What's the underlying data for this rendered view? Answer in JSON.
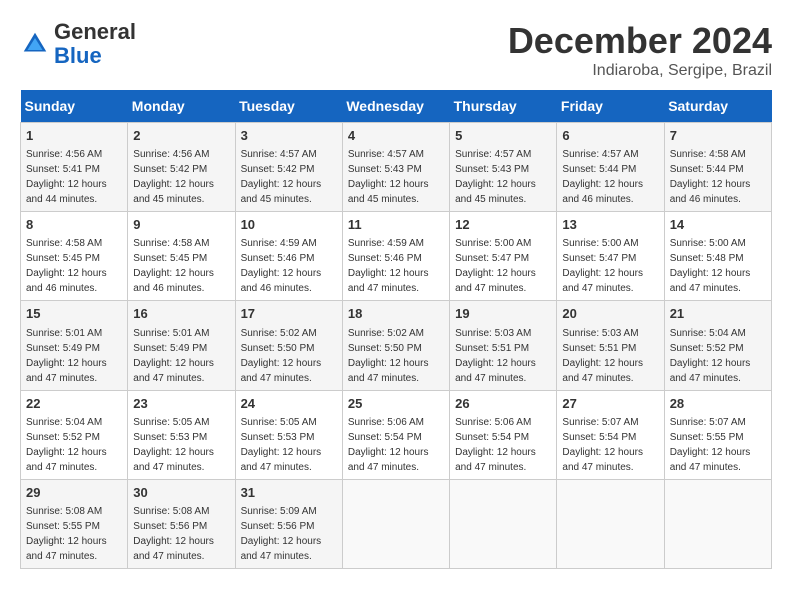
{
  "header": {
    "logo_general": "General",
    "logo_blue": "Blue",
    "month": "December 2024",
    "location": "Indiaroba, Sergipe, Brazil"
  },
  "calendar": {
    "days_of_week": [
      "Sunday",
      "Monday",
      "Tuesday",
      "Wednesday",
      "Thursday",
      "Friday",
      "Saturday"
    ],
    "weeks": [
      [
        {
          "day": "",
          "info": ""
        },
        {
          "day": "2",
          "info": "Sunrise: 4:56 AM\nSunset: 5:42 PM\nDaylight: 12 hours\nand 45 minutes."
        },
        {
          "day": "3",
          "info": "Sunrise: 4:57 AM\nSunset: 5:42 PM\nDaylight: 12 hours\nand 45 minutes."
        },
        {
          "day": "4",
          "info": "Sunrise: 4:57 AM\nSunset: 5:43 PM\nDaylight: 12 hours\nand 45 minutes."
        },
        {
          "day": "5",
          "info": "Sunrise: 4:57 AM\nSunset: 5:43 PM\nDaylight: 12 hours\nand 45 minutes."
        },
        {
          "day": "6",
          "info": "Sunrise: 4:57 AM\nSunset: 5:44 PM\nDaylight: 12 hours\nand 46 minutes."
        },
        {
          "day": "7",
          "info": "Sunrise: 4:58 AM\nSunset: 5:44 PM\nDaylight: 12 hours\nand 46 minutes."
        }
      ],
      [
        {
          "day": "1",
          "info": "Sunrise: 4:56 AM\nSunset: 5:41 PM\nDaylight: 12 hours\nand 44 minutes."
        },
        {
          "day": "",
          "info": ""
        },
        {
          "day": "",
          "info": ""
        },
        {
          "day": "",
          "info": ""
        },
        {
          "day": "",
          "info": ""
        },
        {
          "day": "",
          "info": ""
        },
        {
          "day": "",
          "info": ""
        }
      ],
      [
        {
          "day": "8",
          "info": "Sunrise: 4:58 AM\nSunset: 5:45 PM\nDaylight: 12 hours\nand 46 minutes."
        },
        {
          "day": "9",
          "info": "Sunrise: 4:58 AM\nSunset: 5:45 PM\nDaylight: 12 hours\nand 46 minutes."
        },
        {
          "day": "10",
          "info": "Sunrise: 4:59 AM\nSunset: 5:46 PM\nDaylight: 12 hours\nand 46 minutes."
        },
        {
          "day": "11",
          "info": "Sunrise: 4:59 AM\nSunset: 5:46 PM\nDaylight: 12 hours\nand 47 minutes."
        },
        {
          "day": "12",
          "info": "Sunrise: 5:00 AM\nSunset: 5:47 PM\nDaylight: 12 hours\nand 47 minutes."
        },
        {
          "day": "13",
          "info": "Sunrise: 5:00 AM\nSunset: 5:47 PM\nDaylight: 12 hours\nand 47 minutes."
        },
        {
          "day": "14",
          "info": "Sunrise: 5:00 AM\nSunset: 5:48 PM\nDaylight: 12 hours\nand 47 minutes."
        }
      ],
      [
        {
          "day": "15",
          "info": "Sunrise: 5:01 AM\nSunset: 5:49 PM\nDaylight: 12 hours\nand 47 minutes."
        },
        {
          "day": "16",
          "info": "Sunrise: 5:01 AM\nSunset: 5:49 PM\nDaylight: 12 hours\nand 47 minutes."
        },
        {
          "day": "17",
          "info": "Sunrise: 5:02 AM\nSunset: 5:50 PM\nDaylight: 12 hours\nand 47 minutes."
        },
        {
          "day": "18",
          "info": "Sunrise: 5:02 AM\nSunset: 5:50 PM\nDaylight: 12 hours\nand 47 minutes."
        },
        {
          "day": "19",
          "info": "Sunrise: 5:03 AM\nSunset: 5:51 PM\nDaylight: 12 hours\nand 47 minutes."
        },
        {
          "day": "20",
          "info": "Sunrise: 5:03 AM\nSunset: 5:51 PM\nDaylight: 12 hours\nand 47 minutes."
        },
        {
          "day": "21",
          "info": "Sunrise: 5:04 AM\nSunset: 5:52 PM\nDaylight: 12 hours\nand 47 minutes."
        }
      ],
      [
        {
          "day": "22",
          "info": "Sunrise: 5:04 AM\nSunset: 5:52 PM\nDaylight: 12 hours\nand 47 minutes."
        },
        {
          "day": "23",
          "info": "Sunrise: 5:05 AM\nSunset: 5:53 PM\nDaylight: 12 hours\nand 47 minutes."
        },
        {
          "day": "24",
          "info": "Sunrise: 5:05 AM\nSunset: 5:53 PM\nDaylight: 12 hours\nand 47 minutes."
        },
        {
          "day": "25",
          "info": "Sunrise: 5:06 AM\nSunset: 5:54 PM\nDaylight: 12 hours\nand 47 minutes."
        },
        {
          "day": "26",
          "info": "Sunrise: 5:06 AM\nSunset: 5:54 PM\nDaylight: 12 hours\nand 47 minutes."
        },
        {
          "day": "27",
          "info": "Sunrise: 5:07 AM\nSunset: 5:54 PM\nDaylight: 12 hours\nand 47 minutes."
        },
        {
          "day": "28",
          "info": "Sunrise: 5:07 AM\nSunset: 5:55 PM\nDaylight: 12 hours\nand 47 minutes."
        }
      ],
      [
        {
          "day": "29",
          "info": "Sunrise: 5:08 AM\nSunset: 5:55 PM\nDaylight: 12 hours\nand 47 minutes."
        },
        {
          "day": "30",
          "info": "Sunrise: 5:08 AM\nSunset: 5:56 PM\nDaylight: 12 hours\nand 47 minutes."
        },
        {
          "day": "31",
          "info": "Sunrise: 5:09 AM\nSunset: 5:56 PM\nDaylight: 12 hours\nand 47 minutes."
        },
        {
          "day": "",
          "info": ""
        },
        {
          "day": "",
          "info": ""
        },
        {
          "day": "",
          "info": ""
        },
        {
          "day": "",
          "info": ""
        }
      ]
    ]
  }
}
